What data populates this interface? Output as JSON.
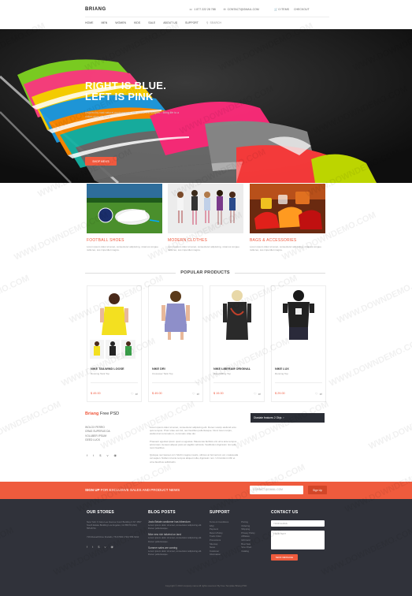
{
  "header": {
    "logo": "BRIANG",
    "phone": "1 877 222 28 788",
    "email": "CONTACT@GMAIL.COM",
    "cart": "0 ITEMS",
    "checkout": "CHECKOUT",
    "nav": [
      "HOME",
      "MEN",
      "WOMEN",
      "KIDS",
      "SALE",
      "ABOUT US",
      "SUPPORT"
    ],
    "search_placeholder": "Search"
  },
  "hero": {
    "title_line1": "RIGHT IS BLUE.",
    "title_line2": "LEFT IS PINK",
    "text": "Inspired by vast natural environments with colors and shapes... Bring life to a colors story of sports.",
    "button": "SHOP MEN'S"
  },
  "categories": [
    {
      "title": "FOOTBALL SHOES",
      "text": "Lorem ipsum dolor sit amet, consectetur adipiscing, vivamus congue nulla leo, sus imperdiet magna."
    },
    {
      "title": "MODERN CLOTHES",
      "text": "Lorem ipsum dolor sit amet, consectetur adipiscing, vivamus congue nulla leo, sus imperdiet magna."
    },
    {
      "title": "BAGS & ACCESSORIES",
      "text": "Lorem ipsum dolor sit amet, consectetur adipiscing, vivamus congue nulla leo, sus imperdiet magna."
    }
  ],
  "popular": {
    "heading": "POPULAR PRODUCTS",
    "products": [
      {
        "name": "NIKE TAILWIND LOOSE",
        "sub": "Running Tank Top",
        "price": "$ 49.00"
      },
      {
        "name": "NIKE DRI",
        "sub": "Crossover Tank Top",
        "price": "$ 49.00"
      },
      {
        "name": "NIKE LIBERAM ORIGINAL",
        "sub": "Weightlifting Top",
        "price": "$ 19.00"
      },
      {
        "name": "NIKE LUX",
        "sub": "Running Top",
        "price": "$ 29.00"
      }
    ]
  },
  "about": {
    "brand": "Briang",
    "suffix": "Free PSD",
    "list": [
      "WOLOX PERRO",
      "GRAS SUPERUS DA",
      "VOLUBER IPSUM",
      "GEED LUCK"
    ],
    "paragraphs": [
      "Lorem ipsum dolor sit amet, consectetur adipiscing elit. Donec suscip eleifend arcu quis tempus. Proin vitae est nisl, nec faucibus pellentesque. Nunc lorem turpis, eleifend at commodo in, commodo vitae dui.",
      "Praesent egestas ipsum quam a egestas. Maecenas facilisis orci urna ante tempus accumsan. Aenean aliquet justo ac sagittis vehicula. Vestibulum dignissim nisi quis nunc faucibus.",
      "Quisque nec laoreet orci. Morbi magna mauris, ultrices at fermentum vel, malesuada vel sapien. Nullam id ante tempus aliquet nulla, dignissim non. Ut tincidunt nibh et urna faucibus sollicitudin."
    ],
    "promo": "Diastate features 2 Objs"
  },
  "signup": {
    "bold": "SIGN UP",
    "rest": " FOR EXCLUSIVE SALES AND PRODUCT NEWS",
    "placeholder": "CONTACT@GMAIL.COM",
    "button": "Sign Up"
  },
  "footer": {
    "stores": {
      "title": "OUR STORES",
      "addr1": "New York: 6 Jane Lee Avenue Court Building 3 NY 4567 South Estate Building Los Angeles, CA 85479 (212) 555-8741",
      "addr2": "716 Russell Drive Franklin, TN 37064 (734) 555-6293"
    },
    "blog": {
      "title": "BLOG POSTS",
      "posts": [
        {
          "title": "Justo Belate cardiomer has bibendum",
          "text": "Lorem ipsum dolor sit amet, consectetur adipiscing elit. Donec pellentesque."
        },
        {
          "title": "Nike new rich tailwind on land",
          "text": "Lorem ipsum dolor sit amet, consectetur adipiscing elit. Donec pellentesque."
        },
        {
          "title": "Summer sales are coming",
          "text": "Lorem ipsum dolor sit amet, consectetur adipiscing elit. Donec pellentesque."
        }
      ]
    },
    "support": {
      "title": "SUPPORT",
      "col1": [
        "Terms & Conditions",
        "FAQ",
        "Payment",
        "Return Policy",
        "Track Order",
        "Promotions",
        "Sitemap",
        "News",
        "Customer",
        "Information"
      ],
      "col2": [
        "Pricing",
        "Ordering",
        "Shipping",
        "Privacy Policy",
        "Affiliates",
        "Gift Card",
        "Best Sale",
        "Size Chart",
        "Catalog"
      ]
    },
    "contact": {
      "title": "CONTACT US",
      "email_placeholder": "YOUR E-MAIL",
      "message_placeholder": "YOUR TEXT",
      "button": "SEND MESSAGE"
    },
    "copyright": "Copyright © 2013 company name All rights reserved. By Free Template Briang PSD"
  },
  "watermark": "WWW.DOWNDEMO.COM",
  "colors": {
    "accent": "#f05a3f",
    "footer": "#30323a",
    "promo": "#2b2e36"
  }
}
